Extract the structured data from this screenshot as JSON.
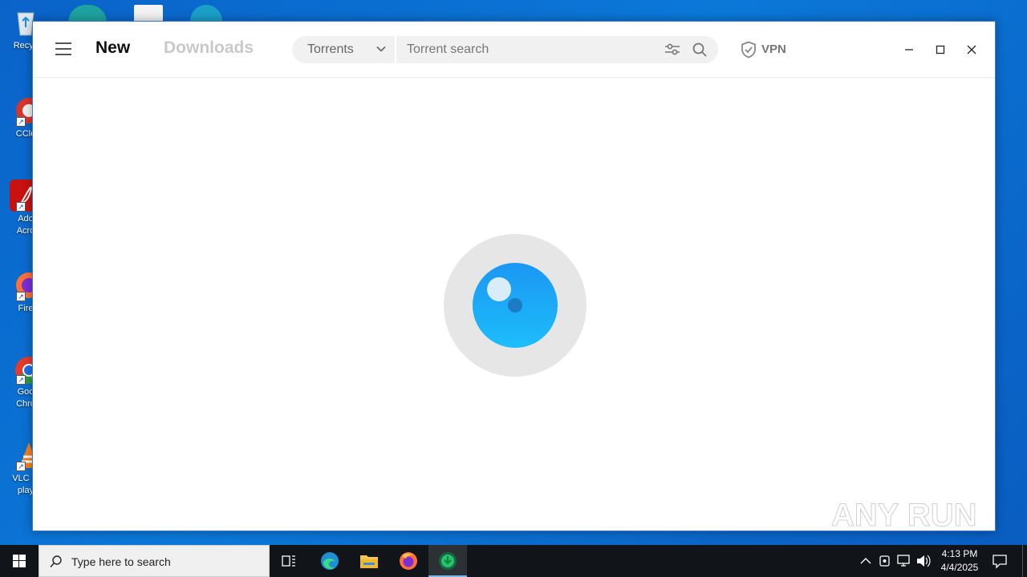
{
  "desktop": {
    "icons": [
      {
        "label": "Recyc",
        "icon": "recycle-bin-icon"
      },
      {
        "label": "CCle",
        "icon": "ccleaner-icon"
      },
      {
        "label": "Ado\nAcro",
        "icon": "adobe-acrobat-icon"
      },
      {
        "label": "Fire",
        "icon": "firefox-icon"
      },
      {
        "label": "Goo\nChro",
        "icon": "chrome-icon"
      },
      {
        "label": "VLC m\nplay",
        "icon": "vlc-icon"
      }
    ]
  },
  "app": {
    "tabs": {
      "new": "New",
      "downloads": "Downloads"
    },
    "search": {
      "category": "Torrents",
      "placeholder": "Torrent search",
      "value": ""
    },
    "vpn_label": "VPN",
    "loading": true,
    "colors": {
      "accent": "#1aa8f7",
      "loader_ring": "#e6e6e6",
      "inactive_tab": "#c9c9c9"
    }
  },
  "watermark": "ANY RUN",
  "taskbar": {
    "search_placeholder": "Type here to search",
    "pinned": [
      "task-view-icon",
      "edge-icon",
      "file-explorer-icon",
      "firefox-icon",
      "torrent-client-icon"
    ],
    "active": "torrent-client-icon",
    "clock": {
      "time": "4:13 PM",
      "date": "4/4/2025"
    }
  }
}
